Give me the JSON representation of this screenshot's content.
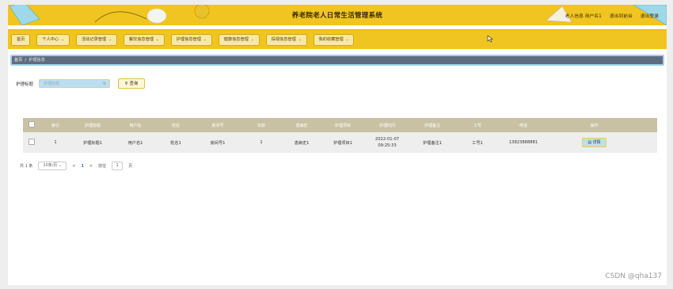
{
  "header": {
    "title": "养老院老人日常生活管理系统",
    "links": [
      "老人信息 用户名1",
      "退出到前台",
      "退出登录"
    ]
  },
  "nav": {
    "items": [
      {
        "label": "首页",
        "dropdown": false
      },
      {
        "label": "个人中心",
        "dropdown": true
      },
      {
        "label": "活动记录管理",
        "dropdown": true
      },
      {
        "label": "餐饮信息管理",
        "dropdown": true
      },
      {
        "label": "护理信息管理",
        "dropdown": true
      },
      {
        "label": "健康信息管理",
        "dropdown": true
      },
      {
        "label": "探视信息管理",
        "dropdown": true
      },
      {
        "label": "我的收藏管理",
        "dropdown": true
      }
    ]
  },
  "breadcrumb": {
    "home": "首页",
    "sep": "/",
    "current": "护理信息"
  },
  "search": {
    "label": "护理标题",
    "placeholder": "护理标题",
    "button": "查询"
  },
  "table": {
    "columns": [
      "",
      "索引",
      "护理标题",
      "用户名",
      "姓名",
      "房间号",
      "年龄",
      "患病史",
      "护理项目",
      "护理时间",
      "护理备注",
      "工号",
      "电话",
      "操作"
    ],
    "rows": [
      [
        "",
        "1",
        "护理标题1",
        "用户名1",
        "姓名1",
        "房间号1",
        "1",
        "患病史1",
        "护理项目1",
        "2022-01-07 09:25:33",
        "护理备注1",
        "工号1",
        "13823888881",
        "详情"
      ]
    ]
  },
  "pagination": {
    "total": "共 1 条",
    "page_size": "10条/页",
    "prev": "<",
    "current": "1",
    "next": ">",
    "goto_label": "前往",
    "goto_value": "1",
    "goto_suffix": "页"
  },
  "watermark": "CSDN @qha137",
  "colors": {
    "header": "#f1c521",
    "table_head": "#c9c1a4",
    "breadcrumb": "#5f6b80"
  }
}
